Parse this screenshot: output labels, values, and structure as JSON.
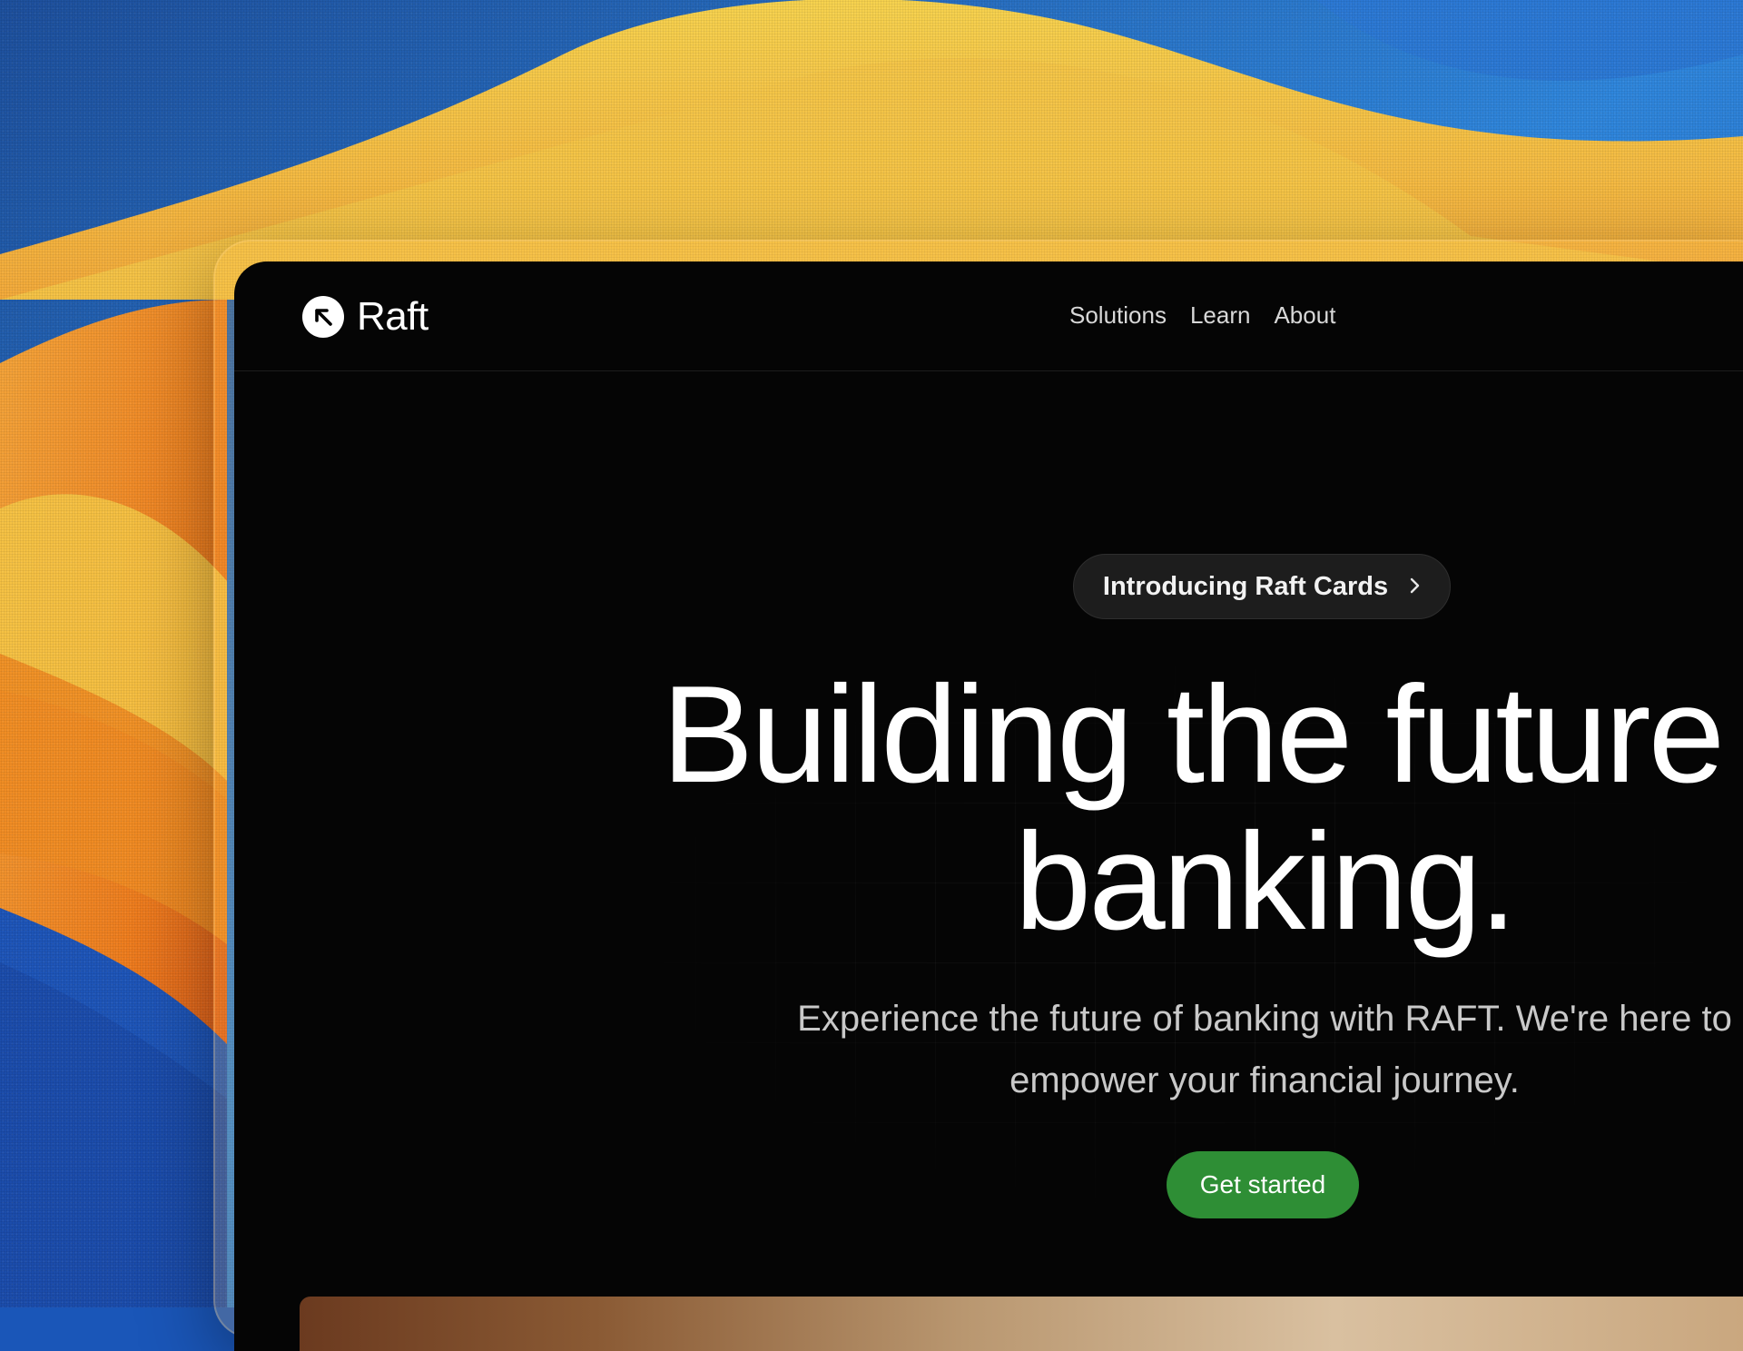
{
  "app": {
    "brand_name": "Raft",
    "logo_icon": "arrow-up-left-icon"
  },
  "nav": {
    "items": [
      "Solutions",
      "Learn",
      "About"
    ]
  },
  "hero": {
    "announcement_label": "Introducing Raft Cards",
    "announcement_icon": "chevron-right-icon",
    "headline_line1": "Building the future of",
    "headline_line2": "banking.",
    "subtitle": "Experience the future of banking with RAFT. We're here to empower your financial journey.",
    "cta_label": "Get started"
  },
  "colors": {
    "background": "#050505",
    "accent_green": "#2e8e35",
    "pill_background": "#1d1d1d",
    "wallpaper_blue": "#2a7ad6",
    "wallpaper_yellow": "#f2c94c",
    "wallpaper_orange": "#f08a1e"
  }
}
